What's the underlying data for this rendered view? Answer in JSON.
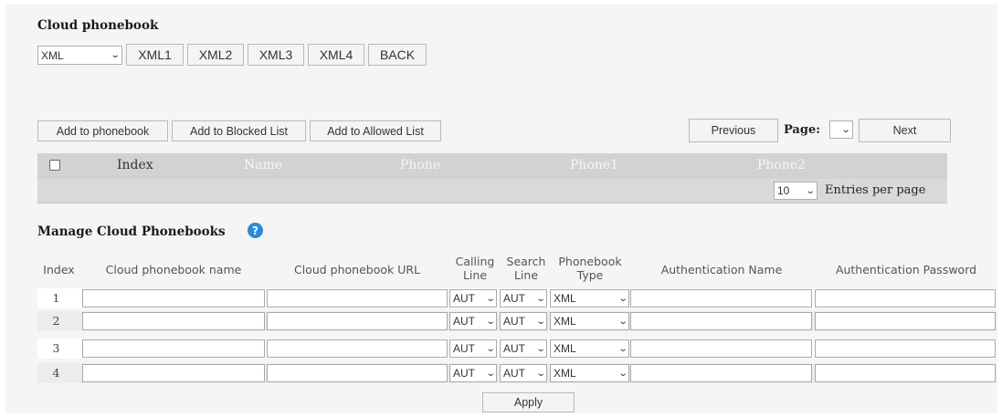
{
  "page": {
    "title": "Cloud phonebook"
  },
  "toolbar": {
    "type_select": "XML",
    "buttons": [
      "XML1",
      "XML2",
      "XML3",
      "XML4",
      "BACK"
    ]
  },
  "actions": {
    "add_to_phonebook": "Add to phonebook",
    "add_to_blocked": "Add to Blocked List",
    "add_to_allowed": "Add to Allowed List",
    "previous": "Previous",
    "page_label": "Page:",
    "page_value": "",
    "next": "Next"
  },
  "contacts_table": {
    "columns": [
      "Index",
      "Name",
      "Phone",
      "Phone1",
      "Phone2"
    ],
    "entries_value": "10",
    "entries_label": "Entries per page"
  },
  "manage": {
    "title": "Manage Cloud Phonebooks",
    "headers": {
      "index": "Index",
      "name": "Cloud phonebook name",
      "url": "Cloud phonebook URL",
      "calling": [
        "Calling",
        "Line"
      ],
      "search": [
        "Search",
        "Line"
      ],
      "type": [
        "Phonebook",
        "Type"
      ],
      "auth_name": "Authentication Name",
      "auth_password": "Authentication Password"
    },
    "rows": [
      {
        "index": "1",
        "calling_line": "AUT",
        "search_line": "AUT",
        "type": "XML"
      },
      {
        "index": "2",
        "calling_line": "AUT",
        "search_line": "AUT",
        "type": "XML"
      },
      {
        "index": "3",
        "calling_line": "AUT",
        "search_line": "AUT",
        "type": "XML"
      },
      {
        "index": "4",
        "calling_line": "AUT",
        "search_line": "AUT",
        "type": "XML"
      }
    ],
    "apply": "Apply"
  },
  "icons": {
    "help": "help-icon",
    "dropdown": "chevron-down-icon"
  },
  "colors": {
    "header_bar": "#d2d2d2",
    "help_icon": "#2b8ad6"
  }
}
